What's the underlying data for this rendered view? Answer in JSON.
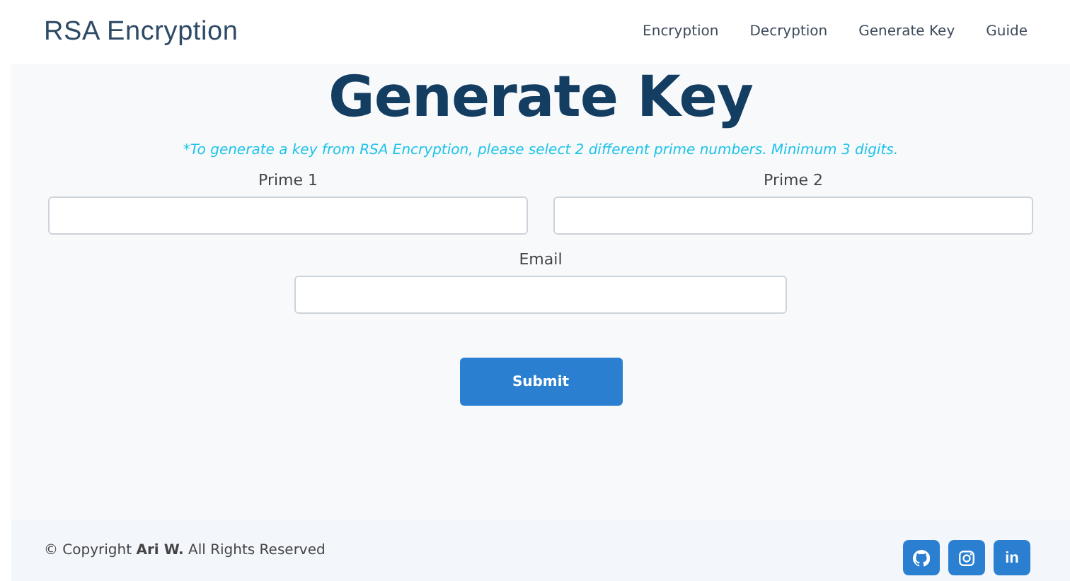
{
  "header": {
    "brand": "RSA Encryption",
    "nav": [
      {
        "label": "Encryption"
      },
      {
        "label": "Decryption"
      },
      {
        "label": "Generate Key"
      },
      {
        "label": "Guide"
      }
    ]
  },
  "main": {
    "title": "Generate Key",
    "note": "*To generate a key from RSA Encryption, please select 2 different prime numbers. Minimum 3 digits.",
    "fields": [
      {
        "label": "Prime 1"
      },
      {
        "label": "Prime 2"
      },
      {
        "label": "Email"
      }
    ],
    "submit": "Submit"
  },
  "footer": {
    "copyright": "© Copyright **Ari W.** All Rights Reserved",
    "social": [
      {
        "kind": "github"
      },
      {
        "kind": "instagram"
      },
      {
        "kind": "linkedin",
        "text": "in"
      }
    ]
  }
}
